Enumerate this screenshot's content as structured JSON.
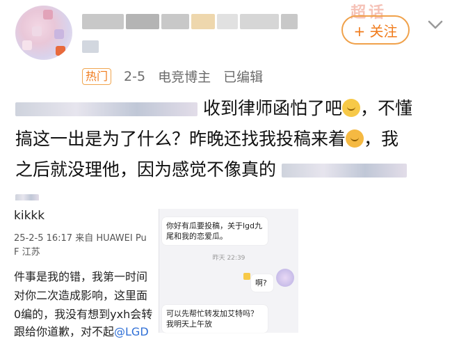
{
  "header": {
    "follow_label": "+ 关注",
    "corner_badge": "超话"
  },
  "meta": {
    "hot_tag": "热门",
    "date": "2-5",
    "role": "电竞博主",
    "edited": "已编辑"
  },
  "post": {
    "line1_text": "收到律师函怕了吧",
    "line1_tail": "，不懂",
    "line2_text": "搞这一出是为了什么？昨晚还找我投稿来着",
    "line2_tail": "，我",
    "line3_text": "之后就没理他，因为感觉不像真的"
  },
  "quote": {
    "username_tail": "kikkk",
    "time_device": "25-2-5 16:17  来自 HUAWEI Pu",
    "location": "F 江苏",
    "line1": "件事是我的错，我第一时间",
    "line2": "对你二次造成影响，这里面",
    "line3": "0编的，我没有想到yxh会转",
    "line4": "跟给你道歉，对不起",
    "mention": "@LGD"
  },
  "chat": {
    "msg1": "你好有瓜要投稿，关于lgd九尾和我的恋爱瓜。",
    "time": "昨天 22:39",
    "msg2": "啊?",
    "msg3": "可以先帮忙转发加艾特吗？我明天上午放"
  },
  "colors": {
    "accent": "#f07b1b",
    "follow_border": "#f0a14a",
    "link": "#2f6fd6"
  },
  "icons": [
    "chevron-down-icon",
    "avatar",
    "emoji-thinking-icon",
    "emoji-flushed-icon"
  ]
}
